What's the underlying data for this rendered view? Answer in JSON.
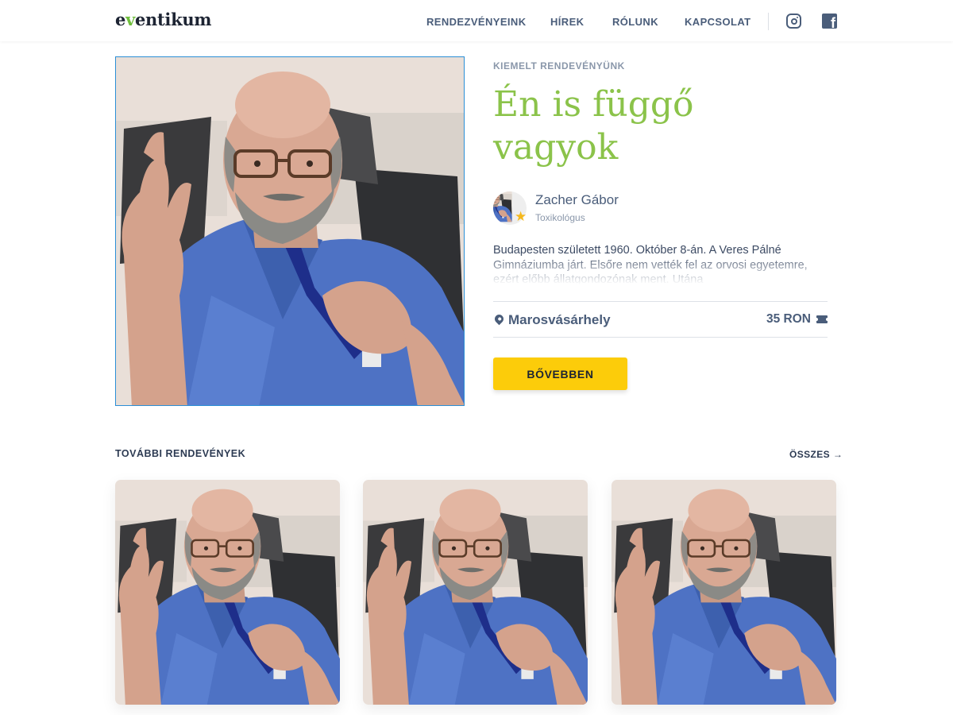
{
  "header": {
    "logo_prefix": "e",
    "logo_v": "v",
    "logo_suffix": "entikum",
    "nav": [
      "RENDEZVÉNYEINK",
      "HÍREK",
      "RÓLUNK",
      "KAPCSOLAT"
    ],
    "social_icons": [
      "instagram-icon",
      "facebook-icon"
    ]
  },
  "featured": {
    "eyebrow": "KIEMELT RENDEVÉNYÜNK",
    "title_line1": "Én is függő",
    "title_line2": "vagyok",
    "speaker_name": "Zacher Gábor",
    "speaker_role": "Toxikológus",
    "description": "Budapesten született 1960. Október 8-án. A Veres Pálné Gimnáziumba járt. Elsőre nem vették fel az orvosi egyetemre, ezért előbb állatgondozónak ment. Utána",
    "location": "Marosvásárhely",
    "price": "35 RON",
    "button_label": "BŐVEBBEN"
  },
  "more": {
    "title": "TOVÁBBI RENDEVÉNYEK",
    "all_label": "ÖSSZES →"
  },
  "colors": {
    "accent_green": "#8bc34a",
    "button_yellow": "#fccc0a",
    "nav_blue": "#4a5d7a",
    "scrubs_blue": "#4e72c4"
  }
}
